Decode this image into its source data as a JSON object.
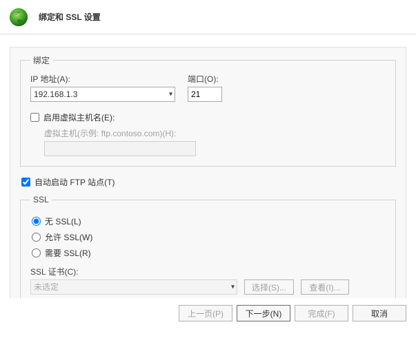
{
  "title": "绑定和 SSL 设置",
  "binding": {
    "legend": "绑定",
    "ip_label": "IP 地址(A):",
    "ip_value": "192.168.1.3",
    "port_label": "端口(O):",
    "port_value": "21",
    "enable_vhost_label": "启用虚拟主机名(E):",
    "enable_vhost_checked": false,
    "vhost_label": "虚拟主机(示例: ftp.contoso.com)(H):",
    "vhost_value": ""
  },
  "auto_start": {
    "label": "自动启动 FTP 站点(T)",
    "checked": true
  },
  "ssl": {
    "legend": "SSL",
    "none_label": "无 SSL(L)",
    "allow_label": "允许 SSL(W)",
    "require_label": "需要 SSL(R)",
    "selected": "none",
    "cert_label": "SSL 证书(C):",
    "cert_value": "未选定",
    "select_button": "选择(S)...",
    "view_button": "查看(I)..."
  },
  "footer": {
    "prev": "上一页(P)",
    "next": "下一步(N)",
    "finish": "完成(F)",
    "cancel": "取消"
  }
}
